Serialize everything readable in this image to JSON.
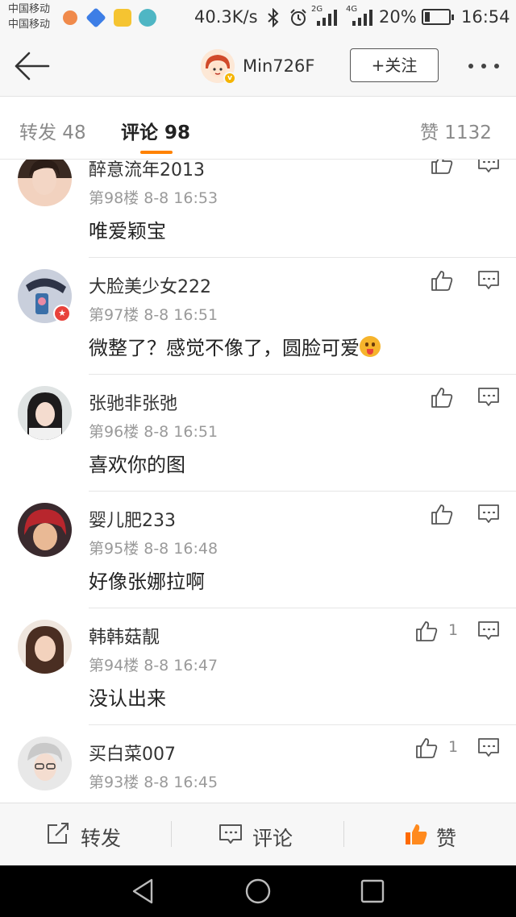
{
  "status_bar": {
    "carrier_1": "中国移动",
    "carrier_2": "中国移动",
    "speed": "40.3K/s",
    "net_2g": "2G",
    "net_4g": "4G",
    "battery": "20%",
    "battery_level": 0.2,
    "time": "16:54"
  },
  "header": {
    "username": "Min726F",
    "follow_label": "+关注"
  },
  "tabs": [
    {
      "label": "转发 48"
    },
    {
      "label": "评论 98"
    },
    {
      "label": "赞 1132"
    }
  ],
  "comments": [
    {
      "name": "醉意流年2013",
      "floor": "第98楼",
      "time": "8-8 16:53",
      "text": "唯爱颖宝",
      "likes": ""
    },
    {
      "name": "大脸美少女222",
      "floor": "第97楼",
      "time": "8-8 16:51",
      "text": "微整了？感觉不像了，圆脸可爱",
      "likes": ""
    },
    {
      "name": "张驰非张弛",
      "floor": "第96楼",
      "time": "8-8 16:51",
      "text": "喜欢你的图",
      "likes": ""
    },
    {
      "name": "婴儿肥233",
      "floor": "第95楼",
      "time": "8-8 16:48",
      "text": "好像张娜拉啊",
      "likes": ""
    },
    {
      "name": "韩韩菇靓",
      "floor": "第94楼",
      "time": "8-8 16:47",
      "text": "没认出来",
      "likes": "1"
    },
    {
      "name": "买白菜007",
      "floor": "第93楼",
      "time": "8-8 16:45",
      "text": "",
      "likes": "1"
    }
  ],
  "action_bar": {
    "repost": "转发",
    "comment": "评论",
    "like": "赞"
  },
  "colors": {
    "accent": "#ff8200",
    "like_active": "#ff6a00"
  }
}
